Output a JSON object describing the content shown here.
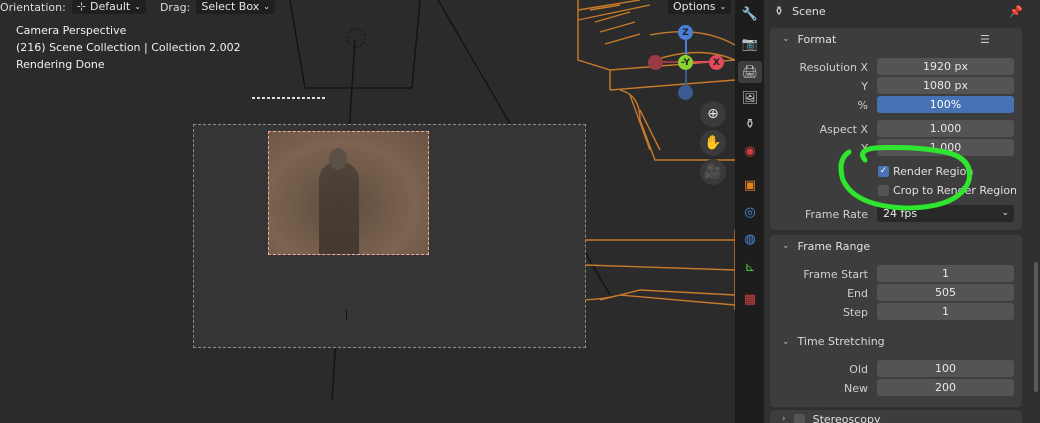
{
  "viewport_header": {
    "orientation_label": "Orientation:",
    "orientation_value": "Default",
    "drag_label": "Drag:",
    "drag_value": "Select Box",
    "options_label": "Options"
  },
  "overlay": {
    "line1": "Camera Perspective",
    "line2": "(216) Scene Collection | Collection 2.002",
    "line3": "Rendering Done"
  },
  "gizmo": {
    "z": "Z",
    "y": "-Y",
    "x": "X"
  },
  "properties": {
    "context_title": "Scene",
    "format_panel": {
      "title": "Format",
      "resolution_x_label": "Resolution X",
      "resolution_x": "1920 px",
      "resolution_y_label": "Y",
      "resolution_y": "1080 px",
      "percent_label": "%",
      "percent": "100%",
      "aspect_x_label": "Aspect X",
      "aspect_x": "1.000",
      "aspect_y_label": "Y",
      "aspect_y": "1.000",
      "render_region_label": "Render Region",
      "render_region_checked": true,
      "crop_label": "Crop to Render Region",
      "crop_checked": false,
      "frame_rate_label": "Frame Rate",
      "frame_rate": "24 fps"
    },
    "frame_range_panel": {
      "title": "Frame Range",
      "start_label": "Frame Start",
      "start": "1",
      "end_label": "End",
      "end": "505",
      "step_label": "Step",
      "step": "1"
    },
    "time_stretching": {
      "title": "Time Stretching",
      "old_label": "Old",
      "old": "100",
      "new_label": "New",
      "new": "200"
    },
    "stereoscopy_panel": {
      "title": "Stereoscopy"
    }
  },
  "colors": {
    "annotation_green": "#2ee62e",
    "accent_blue": "#4772b3",
    "wireframe_orange": "#c77a2a"
  }
}
